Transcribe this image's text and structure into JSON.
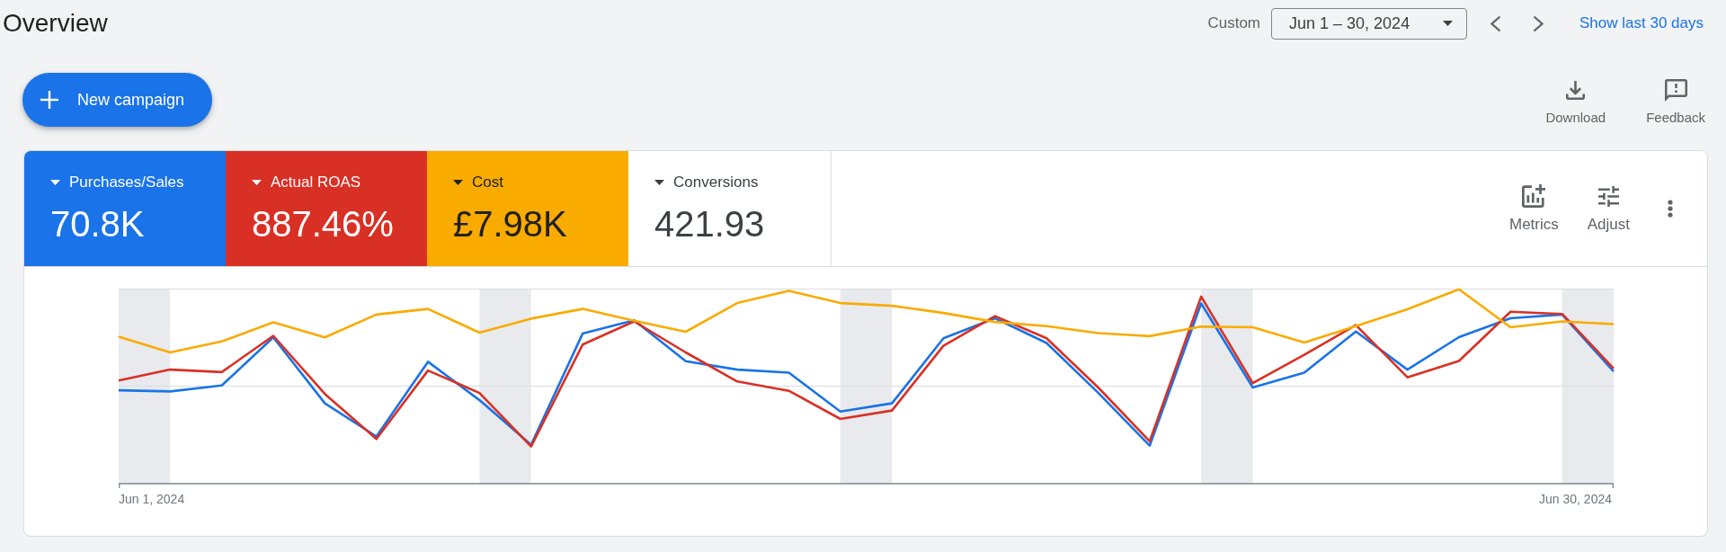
{
  "header": {
    "title": "Overview",
    "date_preset": "Custom",
    "date_range": "Jun 1 – 30, 2024",
    "quick_link": "Show last 30 days"
  },
  "actions": {
    "primary_button": "New campaign",
    "toolbar": [
      {
        "kind": "download",
        "label": "Download"
      },
      {
        "kind": "feedback",
        "label": "Feedback"
      }
    ]
  },
  "card": {
    "metrics": [
      {
        "name": "Purchases/Sales",
        "value": "70.8K",
        "selected": true,
        "color": "#1a73e8"
      },
      {
        "name": "Actual ROAS",
        "value": "887.46%",
        "selected": true,
        "color": "#d93025"
      },
      {
        "name": "Cost",
        "value": "£7.98K",
        "selected": true,
        "color": "#f9ab00"
      },
      {
        "name": "Conversions",
        "value": "421.93",
        "selected": false
      }
    ],
    "tools": [
      {
        "kind": "metrics",
        "label": "Metrics"
      },
      {
        "kind": "adjust",
        "label": "Adjust"
      },
      {
        "kind": "more"
      }
    ],
    "chart": {
      "x_labels": [
        "Jun 1, 2024",
        "Jun 30, 2024"
      ]
    }
  }
}
